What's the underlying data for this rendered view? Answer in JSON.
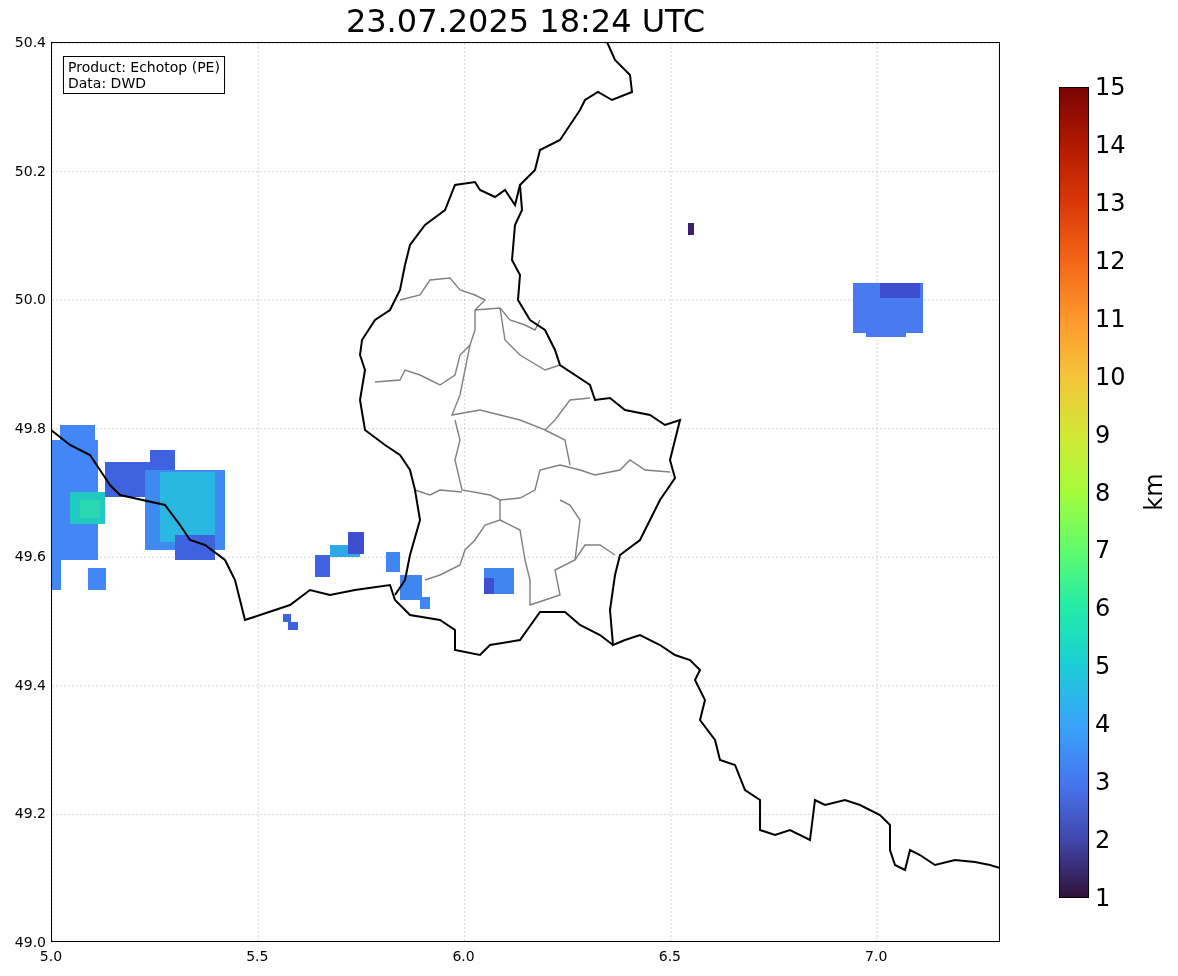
{
  "title": "23.07.2025 18:24 UTC",
  "legend": {
    "lines": [
      "Product: Echotop (PE)",
      "Data: DWD"
    ]
  },
  "map": {
    "y_ticks": [
      "50.4",
      "50.2",
      "50.0",
      "49.8",
      "49.6",
      "49.4",
      "49.2",
      "49.0"
    ],
    "x_ticks": [
      "5.0",
      "5.5",
      "6.0",
      "6.5",
      "7.0"
    ]
  },
  "colorbar": {
    "label": "km",
    "ticks": [
      "15",
      "14",
      "13",
      "12",
      "11",
      "10",
      "9",
      "8",
      "7",
      "6",
      "5",
      "4",
      "3",
      "2",
      "1"
    ]
  }
}
